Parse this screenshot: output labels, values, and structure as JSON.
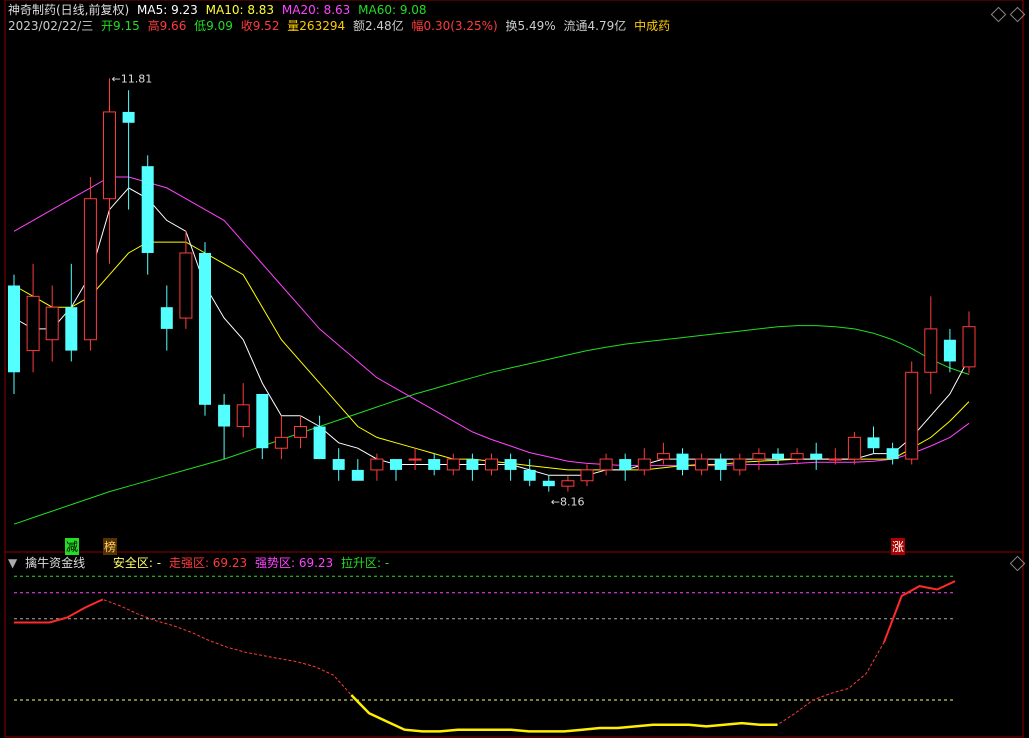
{
  "header": {
    "stock": "神奇制药(日线,前复权)",
    "ma5": "MA5: 9.23",
    "ma10": "MA10: 8.83",
    "ma20": "MA20: 8.63",
    "ma60": "MA60: 9.08",
    "date": "2023/02/22/三",
    "open": "开9.15",
    "high": "高9.66",
    "low": "低9.09",
    "close": "收9.52",
    "volume": "量263294",
    "amount": "额2.48亿",
    "change": "幅0.30(3.25%)",
    "turnover": "换5.49%",
    "float": "流通4.79亿",
    "sector": "中成药"
  },
  "markers": {
    "jian": "减",
    "bang": "榜",
    "zhang": "涨"
  },
  "indicator": {
    "name": "擒牛资金线",
    "safe": "安全区: -",
    "walkstrong": "走强区: 69.23",
    "strong": "强势区: 69.23",
    "pull": "拉升区: -"
  },
  "colors": {
    "up": "#ff3b3b",
    "down": "#54ffff",
    "ma5": "#ffffff",
    "ma10": "#ffff00",
    "ma20": "#ff44ff",
    "ma60": "#22dd22"
  },
  "chart_data": [
    {
      "type": "candlestick",
      "ylim": [
        7.6,
        12.2
      ],
      "annotations": {
        "high": "11.81",
        "low": "8.16"
      },
      "candles": [
        [
          9.9,
          9.1,
          10.0,
          8.9
        ],
        [
          9.3,
          9.8,
          10.1,
          9.1
        ],
        [
          9.4,
          9.7,
          9.9,
          9.2
        ],
        [
          9.7,
          9.3,
          10.1,
          9.2
        ],
        [
          9.4,
          10.7,
          10.9,
          9.3
        ],
        [
          10.7,
          11.5,
          11.81,
          10.1
        ],
        [
          11.5,
          11.4,
          11.7,
          10.6
        ],
        [
          11.0,
          10.2,
          11.1,
          10.0
        ],
        [
          9.7,
          9.5,
          9.9,
          9.3
        ],
        [
          9.6,
          10.2,
          10.4,
          9.5
        ],
        [
          10.2,
          8.8,
          10.3,
          8.7
        ],
        [
          8.8,
          8.6,
          8.9,
          8.3
        ],
        [
          8.6,
          8.8,
          9.0,
          8.5
        ],
        [
          8.9,
          8.4,
          8.9,
          8.3
        ],
        [
          8.4,
          8.5,
          8.7,
          8.3
        ],
        [
          8.5,
          8.6,
          8.7,
          8.4
        ],
        [
          8.6,
          8.3,
          8.7,
          8.3
        ],
        [
          8.3,
          8.2,
          8.4,
          8.1
        ],
        [
          8.2,
          8.1,
          8.3,
          8.16
        ],
        [
          8.2,
          8.3,
          8.35,
          8.1
        ],
        [
          8.3,
          8.2,
          8.3,
          8.1
        ],
        [
          8.3,
          8.3,
          8.4,
          8.2
        ],
        [
          8.3,
          8.2,
          8.35,
          8.15
        ],
        [
          8.2,
          8.3,
          8.35,
          8.15
        ],
        [
          8.3,
          8.2,
          8.35,
          8.1
        ],
        [
          8.2,
          8.3,
          8.35,
          8.15
        ],
        [
          8.3,
          8.2,
          8.35,
          8.1
        ],
        [
          8.2,
          8.1,
          8.3,
          8.05
        ],
        [
          8.1,
          8.05,
          8.15,
          8.0
        ],
        [
          8.05,
          8.1,
          8.15,
          8.0
        ],
        [
          8.1,
          8.2,
          8.25,
          8.05
        ],
        [
          8.2,
          8.3,
          8.35,
          8.15
        ],
        [
          8.3,
          8.2,
          8.35,
          8.1
        ],
        [
          8.2,
          8.3,
          8.4,
          8.15
        ],
        [
          8.3,
          8.35,
          8.45,
          8.25
        ],
        [
          8.35,
          8.2,
          8.4,
          8.15
        ],
        [
          8.2,
          8.3,
          8.35,
          8.15
        ],
        [
          8.3,
          8.2,
          8.35,
          8.1
        ],
        [
          8.2,
          8.3,
          8.35,
          8.15
        ],
        [
          8.3,
          8.35,
          8.4,
          8.2
        ],
        [
          8.35,
          8.3,
          8.4,
          8.25
        ],
        [
          8.3,
          8.35,
          8.4,
          8.25
        ],
        [
          8.35,
          8.3,
          8.45,
          8.2
        ],
        [
          8.3,
          8.3,
          8.4,
          8.25
        ],
        [
          8.3,
          8.5,
          8.55,
          8.25
        ],
        [
          8.5,
          8.4,
          8.6,
          8.35
        ],
        [
          8.4,
          8.3,
          8.45,
          8.25
        ],
        [
          8.3,
          9.1,
          9.2,
          8.25
        ],
        [
          9.1,
          9.5,
          9.8,
          8.9
        ],
        [
          9.4,
          9.2,
          9.5,
          9.1
        ],
        [
          9.15,
          9.52,
          9.66,
          9.09
        ]
      ],
      "ma5": [
        9.6,
        9.5,
        9.5,
        9.7,
        10.0,
        10.6,
        10.8,
        10.7,
        10.5,
        10.4,
        9.9,
        9.6,
        9.4,
        9.0,
        8.7,
        8.7,
        8.6,
        8.45,
        8.4,
        8.3,
        8.25,
        8.25,
        8.25,
        8.25,
        8.25,
        8.25,
        8.25,
        8.2,
        8.15,
        8.15,
        8.15,
        8.2,
        8.2,
        8.25,
        8.3,
        8.3,
        8.3,
        8.3,
        8.3,
        8.3,
        8.3,
        8.3,
        8.3,
        8.3,
        8.3,
        8.35,
        8.35,
        8.5,
        8.7,
        8.9,
        9.23
      ],
      "ma10": [
        9.9,
        9.8,
        9.7,
        9.7,
        9.8,
        10.0,
        10.2,
        10.3,
        10.3,
        10.3,
        10.2,
        10.1,
        10.0,
        9.7,
        9.4,
        9.2,
        9.0,
        8.8,
        8.6,
        8.5,
        8.45,
        8.4,
        8.35,
        8.3,
        8.3,
        8.28,
        8.26,
        8.24,
        8.22,
        8.2,
        8.2,
        8.2,
        8.2,
        8.2,
        8.22,
        8.24,
        8.25,
        8.25,
        8.27,
        8.28,
        8.29,
        8.3,
        8.3,
        8.3,
        8.3,
        8.3,
        8.3,
        8.4,
        8.5,
        8.65,
        8.83
      ],
      "ma20": [
        10.4,
        10.5,
        10.6,
        10.7,
        10.8,
        10.9,
        10.9,
        10.85,
        10.8,
        10.7,
        10.6,
        10.5,
        10.3,
        10.1,
        9.9,
        9.7,
        9.5,
        9.35,
        9.2,
        9.05,
        8.95,
        8.85,
        8.75,
        8.65,
        8.55,
        8.48,
        8.42,
        8.36,
        8.32,
        8.28,
        8.26,
        8.25,
        8.24,
        8.24,
        8.24,
        8.24,
        8.24,
        8.24,
        8.25,
        8.25,
        8.25,
        8.26,
        8.27,
        8.27,
        8.27,
        8.28,
        8.3,
        8.35,
        8.42,
        8.5,
        8.63
      ],
      "ma60": [
        7.7,
        7.76,
        7.82,
        7.88,
        7.94,
        8.0,
        8.05,
        8.1,
        8.15,
        8.2,
        8.25,
        8.3,
        8.36,
        8.42,
        8.48,
        8.54,
        8.6,
        8.66,
        8.72,
        8.78,
        8.84,
        8.9,
        8.95,
        9.0,
        9.05,
        9.1,
        9.14,
        9.18,
        9.22,
        9.26,
        9.3,
        9.33,
        9.36,
        9.38,
        9.4,
        9.42,
        9.44,
        9.46,
        9.48,
        9.5,
        9.52,
        9.53,
        9.53,
        9.52,
        9.5,
        9.46,
        9.4,
        9.32,
        9.22,
        9.14,
        9.08
      ]
    },
    {
      "type": "line",
      "name": "擒牛资金线",
      "ylim": [
        0,
        100
      ],
      "levels": [
        95,
        85,
        69.23,
        20
      ],
      "values": [
        67,
        67,
        67,
        70,
        76,
        81,
        77,
        72,
        68,
        65,
        61,
        56,
        52,
        49,
        47,
        45,
        43,
        40,
        35,
        23,
        12,
        7,
        2,
        1,
        1,
        2,
        2,
        2,
        2,
        1,
        1,
        1,
        2,
        3,
        3,
        4,
        5,
        5,
        5,
        4,
        5,
        6,
        5,
        5,
        12,
        20,
        24,
        27,
        36,
        55,
        83,
        89,
        87,
        92
      ],
      "solid_red": [
        [
          0,
          5
        ]
      ],
      "solid_yellow": [
        [
          19,
          43
        ]
      ],
      "solid_red_end": [
        [
          49,
          53
        ]
      ]
    }
  ]
}
